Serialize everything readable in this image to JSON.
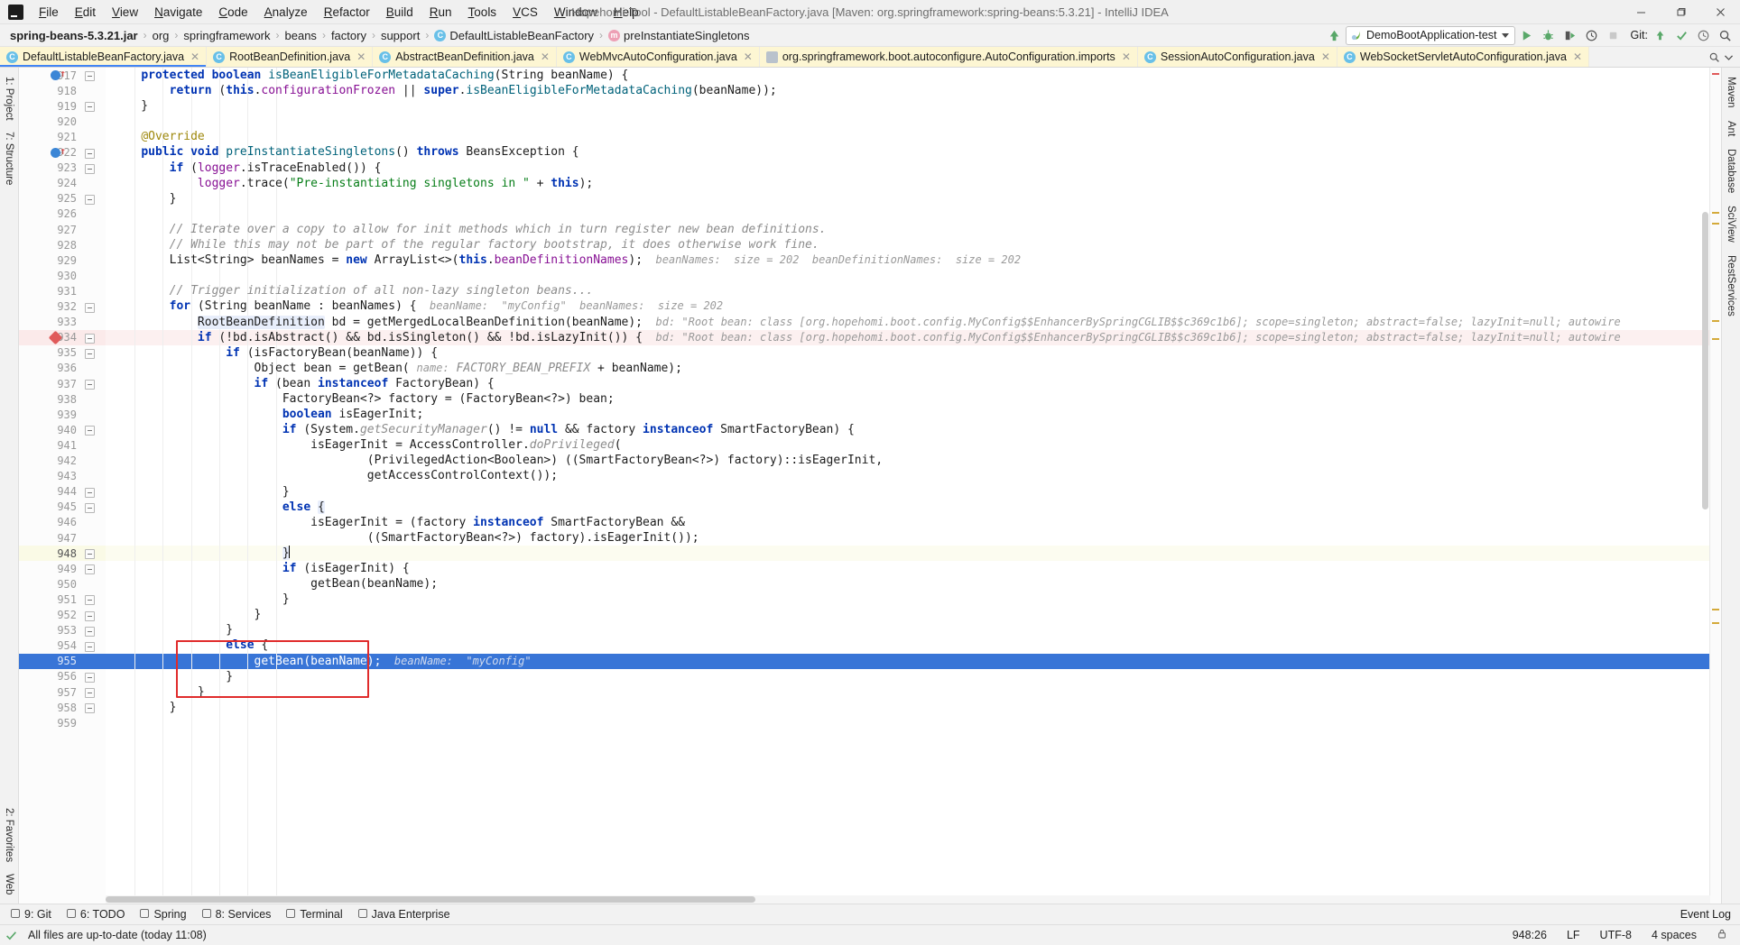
{
  "window": {
    "title": "Hopehomi-Tool - DefaultListableBeanFactory.java [Maven: org.springframework:spring-beans:5.3.21] - IntelliJ IDEA",
    "logo": "IJ",
    "minimize_label": "—",
    "maximize_label": "❐",
    "close_label": "✕"
  },
  "menu": [
    {
      "label": "File",
      "name": "menu-file"
    },
    {
      "label": "Edit",
      "name": "menu-edit"
    },
    {
      "label": "View",
      "name": "menu-view"
    },
    {
      "label": "Navigate",
      "name": "menu-navigate"
    },
    {
      "label": "Code",
      "name": "menu-code"
    },
    {
      "label": "Analyze",
      "name": "menu-analyze"
    },
    {
      "label": "Refactor",
      "name": "menu-refactor"
    },
    {
      "label": "Build",
      "name": "menu-build"
    },
    {
      "label": "Run",
      "name": "menu-run"
    },
    {
      "label": "Tools",
      "name": "menu-tools"
    },
    {
      "label": "VCS",
      "name": "menu-vcs"
    },
    {
      "label": "Window",
      "name": "menu-window"
    },
    {
      "label": "Help",
      "name": "menu-help"
    }
  ],
  "breadcrumbs": [
    {
      "label": "spring-beans-5.3.21.jar",
      "icon": "",
      "bold": true
    },
    {
      "label": "org",
      "icon": ""
    },
    {
      "label": "springframework",
      "icon": ""
    },
    {
      "label": "beans",
      "icon": ""
    },
    {
      "label": "factory",
      "icon": ""
    },
    {
      "label": "support",
      "icon": ""
    },
    {
      "label": "DefaultListableBeanFactory",
      "icon": "class-icon"
    },
    {
      "label": "preInstantiateSingletons",
      "icon": "method-icon"
    }
  ],
  "toolbar": {
    "run_config": "DemoBootApplication-test",
    "run_icon": "run-icon",
    "debug_icon": "debug-icon",
    "coverage_icon": "run-with-coverage-icon",
    "profile_icon": "profiler-icon",
    "stop_icon": "stop-icon",
    "git_label": "Git:",
    "update_icon": "update-project-icon",
    "commit_icon": "commit-icon",
    "history_icon": "vcs-history-icon",
    "search_icon": "search-everywhere-icon"
  },
  "tabs": [
    {
      "label": "DefaultListableBeanFactory.java",
      "icon": "class-icon",
      "active": true
    },
    {
      "label": "RootBeanDefinition.java",
      "icon": "class-icon",
      "active": false
    },
    {
      "label": "AbstractBeanDefinition.java",
      "icon": "class-icon",
      "active": false
    },
    {
      "label": "WebMvcAutoConfiguration.java",
      "icon": "class-icon",
      "active": false
    },
    {
      "label": "org.springframework.boot.autoconfigure.AutoConfiguration.imports",
      "icon": "file-icon",
      "active": false
    },
    {
      "label": "SessionAutoConfiguration.java",
      "icon": "class-icon",
      "active": false
    },
    {
      "label": "WebSocketServletAutoConfiguration.java",
      "icon": "class-icon",
      "active": false
    }
  ],
  "left_tool_tabs": [
    {
      "label": "1: Project",
      "name": "tool-project"
    },
    {
      "label": "7: Structure",
      "name": "tool-structure"
    },
    {
      "label": "2: Favorites",
      "name": "tool-favorites"
    },
    {
      "label": "Web",
      "name": "tool-web"
    }
  ],
  "right_tool_tabs": [
    {
      "label": "Maven",
      "name": "tool-maven"
    },
    {
      "label": "Ant",
      "name": "tool-ant"
    },
    {
      "label": "Database",
      "name": "tool-database"
    },
    {
      "label": "SciView",
      "name": "tool-sciview"
    },
    {
      "label": "RestServices",
      "name": "tool-restservices"
    }
  ],
  "bottom_tool_tabs": [
    {
      "label": "9: Git",
      "name": "tool-git"
    },
    {
      "label": "6: TODO",
      "name": "tool-todo"
    },
    {
      "label": "Spring",
      "name": "tool-spring"
    },
    {
      "label": "8: Services",
      "name": "tool-services"
    },
    {
      "label": "Terminal",
      "name": "tool-terminal"
    },
    {
      "label": "Java Enterprise",
      "name": "tool-java-enterprise"
    }
  ],
  "event_log": "Event Log",
  "status": {
    "message": "All files are up-to-date (today 11:08)",
    "caret": "948:26",
    "line_sep": "LF",
    "encoding": "UTF-8",
    "indent": "4 spaces",
    "lock_icon": "lock-icon"
  },
  "editor": {
    "first_line": 917,
    "selected_line": 955,
    "current_line": 948,
    "exec_line": 934,
    "lines": [
      {
        "n": 917,
        "html": "    <span class='kw'>protected</span> <span class='kw'>boolean</span> <span class='mth'>isBeanEligibleForMetadataCaching</span>(String beanName) {",
        "fold": "start",
        "bp": "blue"
      },
      {
        "n": 918,
        "html": "        <span class='kw'>return</span> (<span class='kw'>this</span>.<span class='fld'>configurationFrozen</span> || <span class='kw'>super</span>.<span class='mth'>isBeanEligibleForMetadataCaching</span>(beanName));"
      },
      {
        "n": 919,
        "html": "    }",
        "fold": "end"
      },
      {
        "n": 920,
        "html": ""
      },
      {
        "n": 921,
        "html": "    <span class='ann'>@Override</span>"
      },
      {
        "n": 922,
        "html": "    <span class='kw'>public</span> <span class='kw'>void</span> <span class='mth'>preInstantiateSingletons</span>() <span class='kw'>throws</span> BeansException {",
        "fold": "start",
        "bp": "blue"
      },
      {
        "n": 923,
        "html": "        <span class='kw'>if</span> (<span class='fld'>logger</span>.isTraceEnabled()) {",
        "fold": "start"
      },
      {
        "n": 924,
        "html": "            <span class='fld'>logger</span>.trace(<span class='str'>\"Pre-instantiating singletons in \"</span> + <span class='kw'>this</span>);"
      },
      {
        "n": 925,
        "html": "        }",
        "fold": "end"
      },
      {
        "n": 926,
        "html": ""
      },
      {
        "n": 927,
        "html": "        <span class='cmt'>// Iterate over a copy to allow for init methods which in turn register new bean definitions.</span>"
      },
      {
        "n": 928,
        "html": "        <span class='cmt'>// While this may not be part of the regular factory bootstrap, it does otherwise work fine.</span>"
      },
      {
        "n": 929,
        "html": "        List&lt;String&gt; beanNames = <span class='kw'>new</span> ArrayList&lt;&gt;(<span class='kw'>this</span>.<span class='fld'>beanDefinitionNames</span>);<span class='hint'>  beanNames:  size = 202  beanDefinitionNames:  size = 202</span>"
      },
      {
        "n": 930,
        "html": ""
      },
      {
        "n": 931,
        "html": "        <span class='cmt'>// Trigger initialization of all non-lazy singleton beans...</span>"
      },
      {
        "n": 932,
        "html": "        <span class='kw'>for</span> (String beanName : beanNames) {<span class='hint'>  beanName:  \"myConfig\"  beanNames:  size = 202</span>",
        "fold": "start"
      },
      {
        "n": 933,
        "html": "            <span class='pill'>RootBeanDefinition</span> bd = getMergedLocalBeanDefinition(beanName);<span class='hint'>  bd: \"Root bean: class [org.hopehomi.boot.config.MyConfig$$EnhancerBySpringCGLIB$$c369c1b6]; scope=singleton; abstract=false; lazyInit=null; autowire</span>"
      },
      {
        "n": 934,
        "html": "            <span class='kw'>if</span> (!bd.isAbstract() &amp;&amp; bd.isSingleton() &amp;&amp; !bd.isLazyInit()) {<span class='hint'>  bd: \"Root bean: class [org.hopehomi.boot.config.MyConfig$$EnhancerBySpringCGLIB$$c369c1b6]; scope=singleton; abstract=false; lazyInit=null; autowire</span>",
        "fold": "start",
        "bp": "red"
      },
      {
        "n": 935,
        "html": "                <span class='kw'>if</span> (isFactoryBean(beanName)) {",
        "fold": "start"
      },
      {
        "n": 936,
        "html": "                    Object bean = getBean( <span class='hint'>name:</span> <span class='cmt'>FACTORY_BEAN_PREFIX</span> + beanName);"
      },
      {
        "n": 937,
        "html": "                    <span class='kw'>if</span> (bean <span class='kw'>instanceof</span> FactoryBean) {",
        "fold": "start"
      },
      {
        "n": 938,
        "html": "                        FactoryBean&lt;?&gt; factory = (FactoryBean&lt;?&gt;) bean;"
      },
      {
        "n": 939,
        "html": "                        <span class='kw'>boolean</span> isEagerInit;"
      },
      {
        "n": 940,
        "html": "                        <span class='kw'>if</span> (System.<span class='cmt'>getSecurityManager</span>() != <span class='kw'>null</span> &amp;&amp; factory <span class='kw'>instanceof</span> SmartFactoryBean) {",
        "fold": "start"
      },
      {
        "n": 941,
        "html": "                            isEagerInit = AccessController.<span class='cmt'>doPrivileged</span>("
      },
      {
        "n": 942,
        "html": "                                    (PrivilegedAction&lt;Boolean&gt;) ((SmartFactoryBean&lt;?&gt;) factory)::isEagerInit,"
      },
      {
        "n": 943,
        "html": "                                    getAccessControlContext());"
      },
      {
        "n": 944,
        "html": "                        }",
        "fold": "end"
      },
      {
        "n": 945,
        "html": "                        <span class='kw'>else</span> <span class='pill'>{</span>",
        "fold": "start"
      },
      {
        "n": 946,
        "html": "                            isEagerInit = (factory <span class='kw'>instanceof</span> SmartFactoryBean &amp;&amp;"
      },
      {
        "n": 947,
        "html": "                                    ((SmartFactoryBean&lt;?&gt;) factory).isEagerInit());"
      },
      {
        "n": 948,
        "html": "                        <span class='pill'>}</span><span class='caretmk'></span>",
        "fold": "end"
      },
      {
        "n": 949,
        "html": "                        <span class='kw'>if</span> (isEagerInit) {",
        "fold": "start"
      },
      {
        "n": 950,
        "html": "                            getBean(beanName);"
      },
      {
        "n": 951,
        "html": "                        }",
        "fold": "end"
      },
      {
        "n": 952,
        "html": "                    }",
        "fold": "end"
      },
      {
        "n": 953,
        "html": "                }",
        "fold": "end"
      },
      {
        "n": 954,
        "html": "                <span class='kw'>else</span> {",
        "fold": "start"
      },
      {
        "n": 955,
        "html": "                    getBean(beanName);<span class='hint'>  beanName:  \"myConfig\"</span>"
      },
      {
        "n": 956,
        "html": "                }",
        "fold": "end"
      },
      {
        "n": 957,
        "html": "            }",
        "fold": "end"
      },
      {
        "n": 958,
        "html": "        }",
        "fold": "end"
      },
      {
        "n": 959,
        "html": ""
      }
    ]
  }
}
